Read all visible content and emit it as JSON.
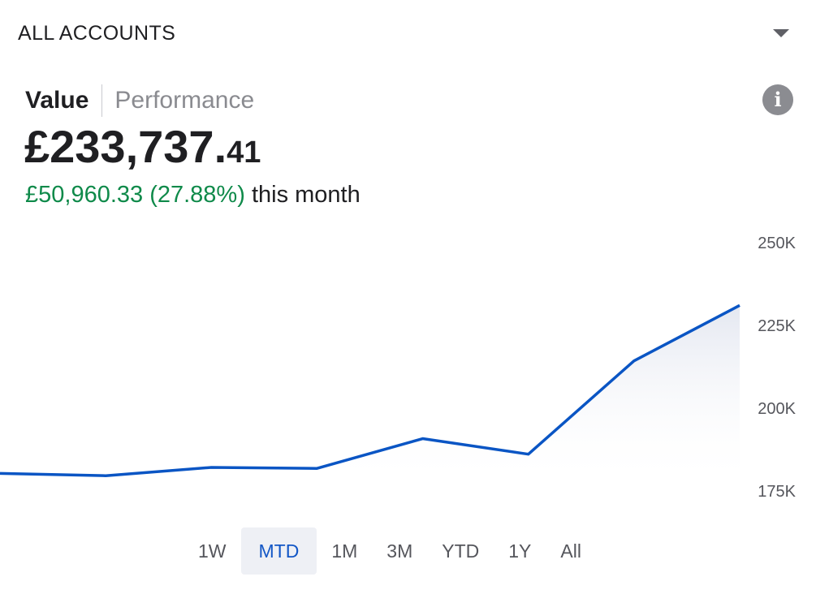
{
  "account": {
    "selector_label": "ALL ACCOUNTS",
    "caret_icon": "caret-down-icon"
  },
  "tabs": [
    {
      "label": "Value",
      "active": true
    },
    {
      "label": "Performance",
      "active": false
    }
  ],
  "info_icon": {
    "name": "info-icon",
    "glyph": "i"
  },
  "balance": {
    "major": "£233,737.",
    "minor": "41"
  },
  "change": {
    "amount": "£50,960.33 (27.88%)",
    "period": "this month",
    "color": "#0f8a4a"
  },
  "chart_data": {
    "type": "area",
    "y_ticks": [
      "250K",
      "225K",
      "200K",
      "175K"
    ],
    "y_tick_values": [
      250000,
      225000,
      200000,
      175000
    ],
    "ylim": [
      175000,
      250000
    ],
    "series": [
      {
        "values": [
          183000,
          182300,
          184800,
          184500,
          193500,
          188800,
          217000,
          233737.41
        ]
      }
    ],
    "line_color": "#0a55c4",
    "grid": false
  },
  "ranges": [
    {
      "label": "1W",
      "active": false
    },
    {
      "label": "MTD",
      "active": true
    },
    {
      "label": "1M",
      "active": false
    },
    {
      "label": "3M",
      "active": false
    },
    {
      "label": "YTD",
      "active": false
    },
    {
      "label": "1Y",
      "active": false
    },
    {
      "label": "All",
      "active": false
    }
  ]
}
